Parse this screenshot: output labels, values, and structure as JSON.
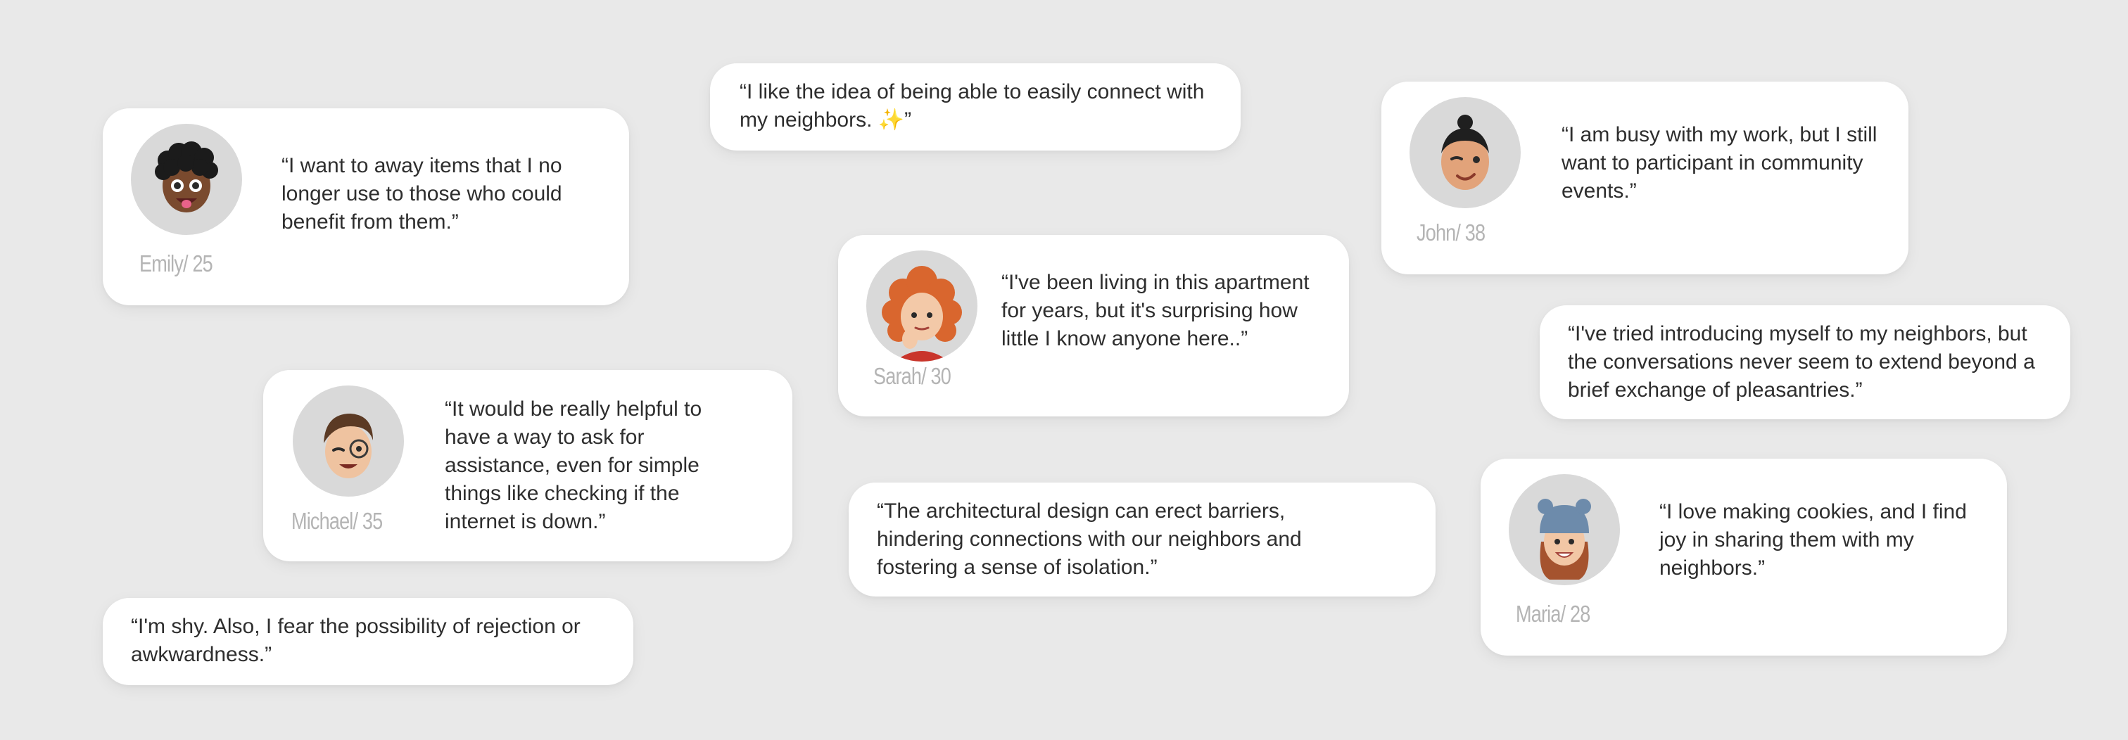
{
  "testimonials": [
    {
      "id": "emily",
      "name": "Emily/ 25",
      "quote": "“I want to away items that I no longer use to those who could benefit from them.”",
      "avatar": "emily-memoji-icon"
    },
    {
      "id": "neighbors-connect",
      "quote_before": "“I like the idea of being able to easily connect with my neighbors. ",
      "quote_after": "”",
      "sparkle": "✨"
    },
    {
      "id": "john",
      "name": "John/ 38",
      "quote": "“I am busy with my work, but I still want to participant in community events.”",
      "avatar": "john-memoji-icon"
    },
    {
      "id": "sarah",
      "name": "Sarah/ 30",
      "quote": "“I've been living in this apartment for years, but it's surprising how little I know anyone here..”",
      "avatar": "sarah-memoji-icon"
    },
    {
      "id": "introductions",
      "quote": "“I've tried introducing myself to my neighbors, but the conversations never seem to extend beyond a brief exchange of pleasantries.”"
    },
    {
      "id": "michael",
      "name": "Michael/ 35",
      "quote": "“It would be really helpful to have a way to ask for assistance, even for simple things like checking if the internet is down.”",
      "avatar": "michael-memoji-icon"
    },
    {
      "id": "architecture",
      "quote": "“The architectural design can erect barriers, hindering connections with our neighbors and fostering a sense of isolation.”"
    },
    {
      "id": "maria",
      "name": "Maria/ 28",
      "quote": "“I love making cookies, and I find joy in sharing them with my neighbors.”",
      "avatar": "maria-memoji-icon"
    },
    {
      "id": "shy",
      "quote": "“I'm shy. Also, I fear the possibility of rejection or awkwardness.”"
    }
  ],
  "colors": {
    "background": "#e9e9e9",
    "card": "#ffffff",
    "avatar_bg": "#d9d9d9",
    "name_text": "#b4b4b4",
    "quote_text": "#2e2e2e"
  }
}
